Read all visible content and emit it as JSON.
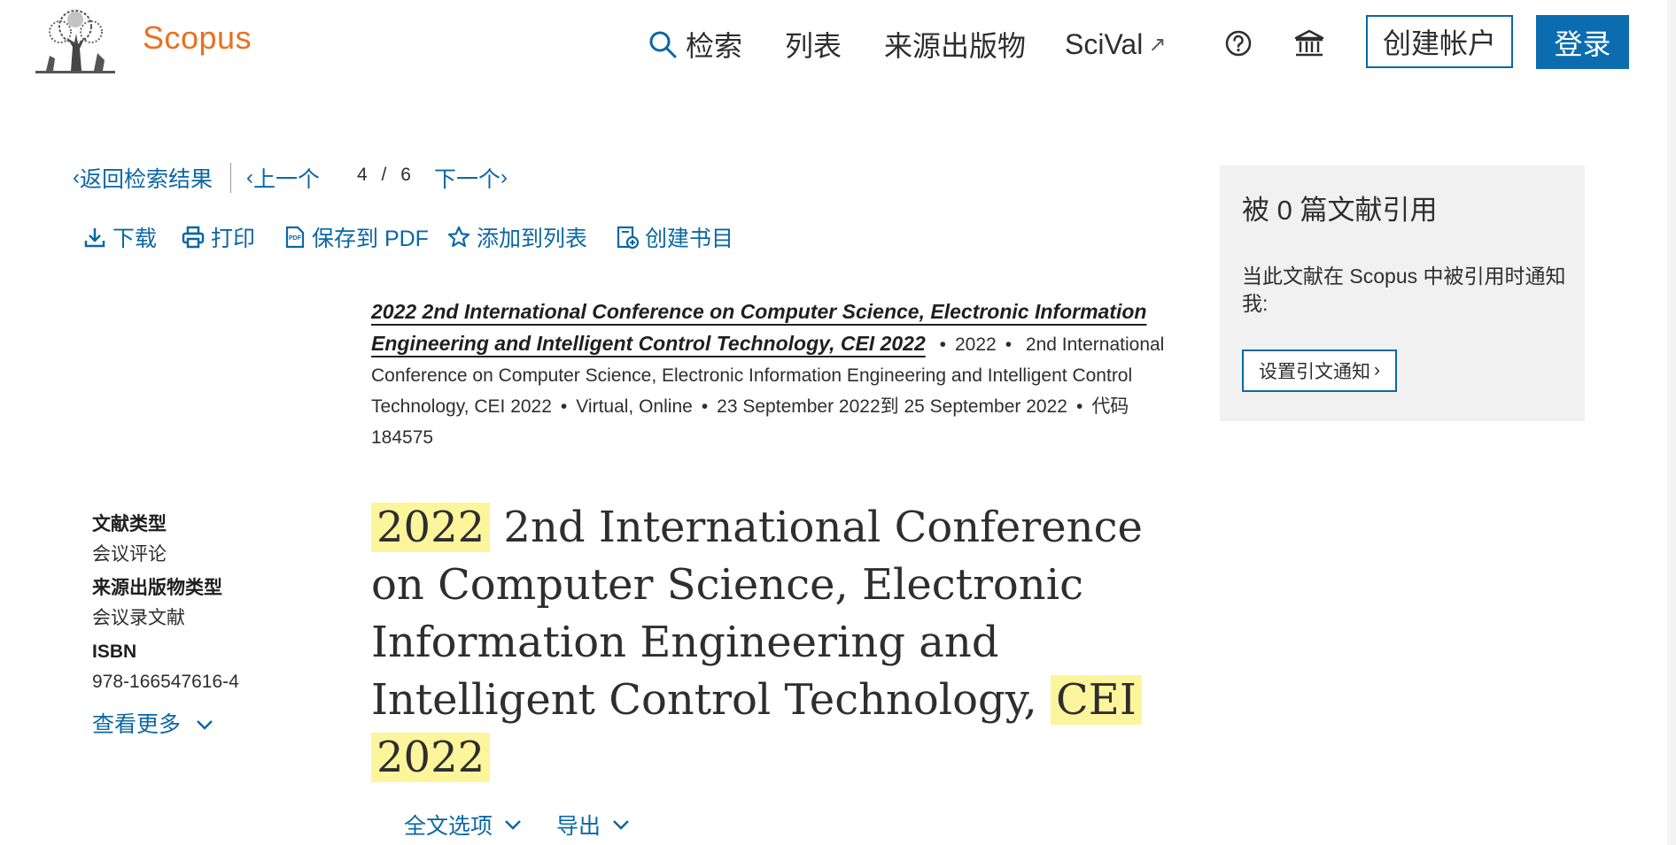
{
  "header": {
    "brand": "Scopus",
    "nav": {
      "search": "检索",
      "lists": "列表",
      "sources": "来源出版物",
      "scival": "SciVal"
    },
    "create_account": "创建帐户",
    "login": "登录"
  },
  "breadcrumb": {
    "back": "返回检索结果",
    "prev": "上一个",
    "current": "4",
    "separator": "/",
    "total": "6",
    "next": "下一个"
  },
  "actions": {
    "download": "下载",
    "print": "打印",
    "save_pdf": "保存到 PDF",
    "add_to_list": "添加到列表",
    "create_bibliography": "创建书目"
  },
  "source": {
    "title": "2022 2nd International Conference on Computer Science, Electronic Information Engineering and Intelligent Control Technology, CEI 2022",
    "year": "2022",
    "conference": "2nd International Conference on Computer Science, Electronic Information Engineering and Intelligent Control Technology, CEI 2022",
    "location": "Virtual, Online",
    "dates": "23 September 2022到 25 September 2022",
    "code": "代码 184575"
  },
  "metadata": {
    "doc_type_label": "文献类型",
    "doc_type_value": "会议评论",
    "source_type_label": "来源出版物类型",
    "source_type_value": "会议录文献",
    "isbn_label": "ISBN",
    "isbn_value": "978-166547616-4",
    "view_more": "查看更多"
  },
  "document_title": {
    "year1": "2022",
    "part1": "2nd International Conference on Computer Science, Electronic Information Engineering and Intelligent Control Technology,",
    "acronym": "CEI",
    "year2": "2022"
  },
  "bottom_links": {
    "full_text": "全文选项",
    "export": "导出"
  },
  "citations_panel": {
    "title": "被 0 篇文献引用",
    "text": "当此文献在 Scopus 中被引用时通知我:",
    "button": "设置引文通知"
  },
  "colors": {
    "brand_orange": "#e9711c",
    "link_blue": "#0b67a4",
    "highlight": "#fdf59c",
    "panel_bg": "#f1f1f1"
  },
  "icons": [
    "elsevier-tree-logo",
    "search-icon",
    "external-link-icon",
    "help-icon",
    "institution-icon",
    "download-icon",
    "print-icon",
    "pdf-icon",
    "star-icon",
    "bibliography-icon",
    "chevron-down-icon"
  ]
}
